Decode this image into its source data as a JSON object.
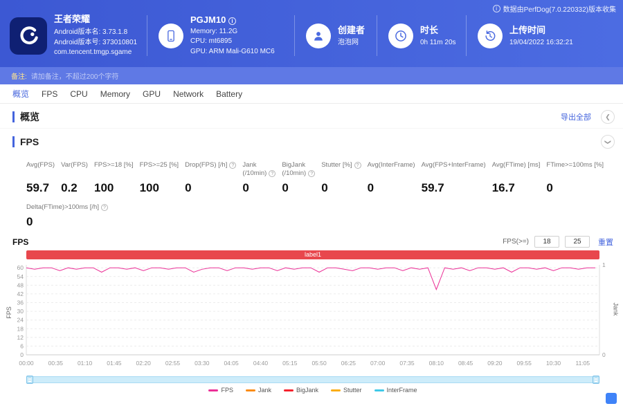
{
  "source_note": {
    "text": "数据由PerfDog(7.0.220332)版本收集"
  },
  "header": {
    "app": {
      "name": "王者荣耀",
      "version_name": "Android版本名: 3.73.1.8",
      "version_code": "Android版本号: 373010801",
      "package": "com.tencent.tmgp.sgame"
    },
    "device": {
      "model": "PGJM10",
      "memory": "Memory: 11.2G",
      "cpu": "CPU: mt6895",
      "gpu": "GPU: ARM Mali-G610 MC6"
    },
    "creator": {
      "label": "创建者",
      "name": "泡泡网"
    },
    "duration": {
      "label": "时长",
      "value": "0h 11m 20s"
    },
    "upload": {
      "label": "上传时间",
      "value": "19/04/2022 16:32:21"
    }
  },
  "notes": {
    "label": "备注:",
    "placeholder": "请加备注，不超过200个字符"
  },
  "tabs": {
    "active": "概览",
    "items": [
      "概览",
      "FPS",
      "CPU",
      "Memory",
      "GPU",
      "Network",
      "Battery"
    ]
  },
  "overview": {
    "title": "概览",
    "export_all": "导出全部"
  },
  "fps": {
    "title": "FPS",
    "chart_label": "FPS",
    "controls": {
      "label": "FPS(>=)",
      "threshold1": "18",
      "threshold2": "25",
      "reset": "重置"
    },
    "metrics": [
      {
        "label": "Avg(FPS)",
        "value": "59.7"
      },
      {
        "label": "Var(FPS)",
        "value": "0.2"
      },
      {
        "label": "FPS>=18 [%]",
        "value": "100"
      },
      {
        "label": "FPS>=25 [%]",
        "value": "100"
      },
      {
        "label": "Drop(FPS) [/h]",
        "info": true,
        "value": "0"
      },
      {
        "label": "Jank\n(/10min)",
        "info": true,
        "value": "0"
      },
      {
        "label": "BigJank\n(/10min)",
        "info": true,
        "value": "0"
      },
      {
        "label": "Stutter [%]",
        "info": true,
        "value": "0"
      },
      {
        "label": "Avg(InterFrame)",
        "value": "0"
      },
      {
        "label": "Avg(FPS+InterFrame)",
        "value": "59.7"
      },
      {
        "label": "Avg(FTime) [ms]",
        "value": "16.7"
      },
      {
        "label": "FTime>=100ms [%]",
        "value": "0"
      }
    ],
    "metrics_row2": [
      {
        "label": "Delta(FTime)>100ms [/h]",
        "info": true,
        "value": "0"
      }
    ]
  },
  "chart_data": {
    "type": "line",
    "banner": "label1",
    "x_tick_labels": [
      "00:00",
      "00:35",
      "01:10",
      "01:45",
      "02:20",
      "02:55",
      "03:30",
      "04:05",
      "04:40",
      "05:15",
      "05:50",
      "06:25",
      "07:00",
      "07:35",
      "08:10",
      "08:45",
      "09:20",
      "09:55",
      "10:30",
      "11:05"
    ],
    "x_tick_interval_s": 35,
    "sample_interval_s": 10,
    "duration_s": 685,
    "y_left": {
      "label": "FPS",
      "ticks": [
        0,
        6,
        12,
        18,
        24,
        30,
        36,
        42,
        48,
        54,
        60
      ],
      "max": 62
    },
    "y_right": {
      "label": "Jank",
      "ticks": [
        0,
        1
      ]
    },
    "series": [
      {
        "name": "FPS",
        "color": "#eb2f96",
        "values": [
          60,
          59,
          60,
          60,
          58,
          60,
          59,
          60,
          60,
          57,
          60,
          60,
          59,
          60,
          58,
          60,
          60,
          59,
          60,
          60,
          57,
          59,
          60,
          60,
          58,
          60,
          60,
          59,
          60,
          60,
          58,
          60,
          59,
          60,
          60,
          57,
          60,
          60,
          59,
          58,
          60,
          60,
          59,
          60,
          60,
          58,
          60,
          59,
          60,
          45,
          60,
          59,
          60,
          58,
          60,
          60,
          59,
          60,
          57,
          60,
          60,
          59,
          60,
          58,
          60,
          60,
          59,
          60,
          60
        ]
      },
      {
        "name": "Jank",
        "color": "#fa8c16",
        "constant": 0
      },
      {
        "name": "BigJank",
        "color": "#f5222d",
        "constant": 0
      },
      {
        "name": "Stutter",
        "color": "#faad14",
        "constant": 0
      },
      {
        "name": "InterFrame",
        "color": "#40c9e8",
        "constant": 0
      }
    ],
    "legend_position": "bottom",
    "grid": true
  },
  "theme": {
    "accent": "#4464dd",
    "header_blue": "#3c58d3",
    "banner_red": "#e8474d",
    "notes_blue": "#5f79e5",
    "scrollbar_blue": "#cdecfa"
  }
}
